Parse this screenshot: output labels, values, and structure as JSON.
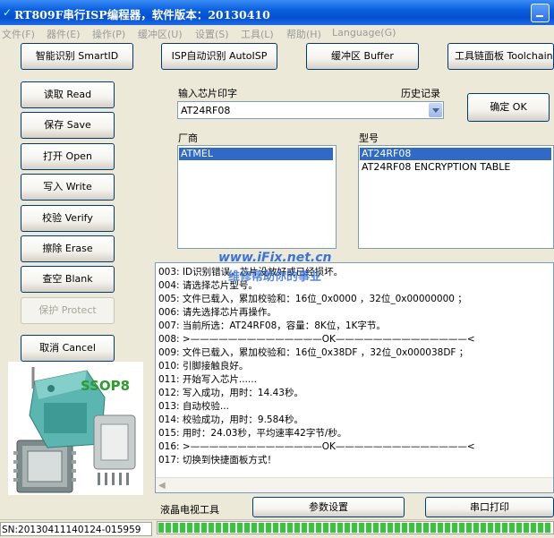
{
  "window": {
    "title": "RT809F串行ISP编程器，软件版本：20130410"
  },
  "menu": [
    "文件(F)",
    "器件(E)",
    "操作(P)",
    "缓冲区(U)",
    "设置(S)",
    "工具(L)",
    "帮助(H)",
    "Language(G)"
  ],
  "top_buttons": {
    "smartid": "智能识别 SmartID",
    "autoisp": "ISP自动识别 AutoISP",
    "buffer": "缓冲区 Buffer",
    "toolchain": "工具链面板 Toolchain"
  },
  "side_buttons": {
    "read": "读取 Read",
    "save": "保存 Save",
    "open": "打开 Open",
    "write": "写入 Write",
    "verify": "校验 Verify",
    "erase": "擦除 Erase",
    "blank": "查空 Blank",
    "protect": "保护 Protect",
    "cancel": "取消 Cancel"
  },
  "chip_input": {
    "label": "输入芯片印字",
    "history_label": "历史记录",
    "value": "AT24RF08",
    "ok_button": "确定 OK"
  },
  "vendor": {
    "label": "厂商",
    "items": [
      {
        "text": "ATMEL",
        "selected": true
      }
    ]
  },
  "model": {
    "label": "型号",
    "items": [
      {
        "text": "AT24RF08",
        "selected": true
      },
      {
        "text": "AT24RF08 ENCRYPTION TABLE",
        "selected": false
      }
    ]
  },
  "log_lines": [
    "003: ID识别错误，芯片没放好或已经损坏。",
    "004: 请选择芯片型号。",
    "005: 文件已载入，累加校验和：16位_0x0000 ，32位_0x00000000 ；",
    "006: 请先选择芯片再操作。",
    "007: 当前所选：AT24RF08，容量：8K位，1K字节。",
    "008: >——————————————OK——————————————<",
    "009: 文件已载入，累加校验和：16位_0x38DF ，32位_0x000038DF ；",
    "010: 引脚接触良好。",
    "011: 开始写入芯片......",
    "012: 写入成功，用时：14.43秒。",
    "013: 自动校验...",
    "014: 校验成功，用时：9.584秒。",
    "015: 用时：24.03秒，平均速率42字节/秒。",
    "016: >——————————————OK——————————————<",
    "017: 切换到快捷面板方式！"
  ],
  "watermark": {
    "url": "www.iFix.net.cn",
    "slogan": "维修帮助你的事业"
  },
  "device_image": {
    "package_label": "SSOP8"
  },
  "bottom": {
    "tv_tool_label": "液晶电视工具",
    "params_button": "参数设置",
    "serial_print_button": "串口打印"
  },
  "status": {
    "serial_number": "SN:20130411140124-015959",
    "progress": 1.0
  },
  "colors": {
    "title_bar": "#0A5FDE",
    "selection": "#316AC5",
    "progress_fill": "#36C63C",
    "window_bg": "#ECE9D8",
    "watermark": "#1E5FD8",
    "device_teal": "#5BB5B0"
  }
}
